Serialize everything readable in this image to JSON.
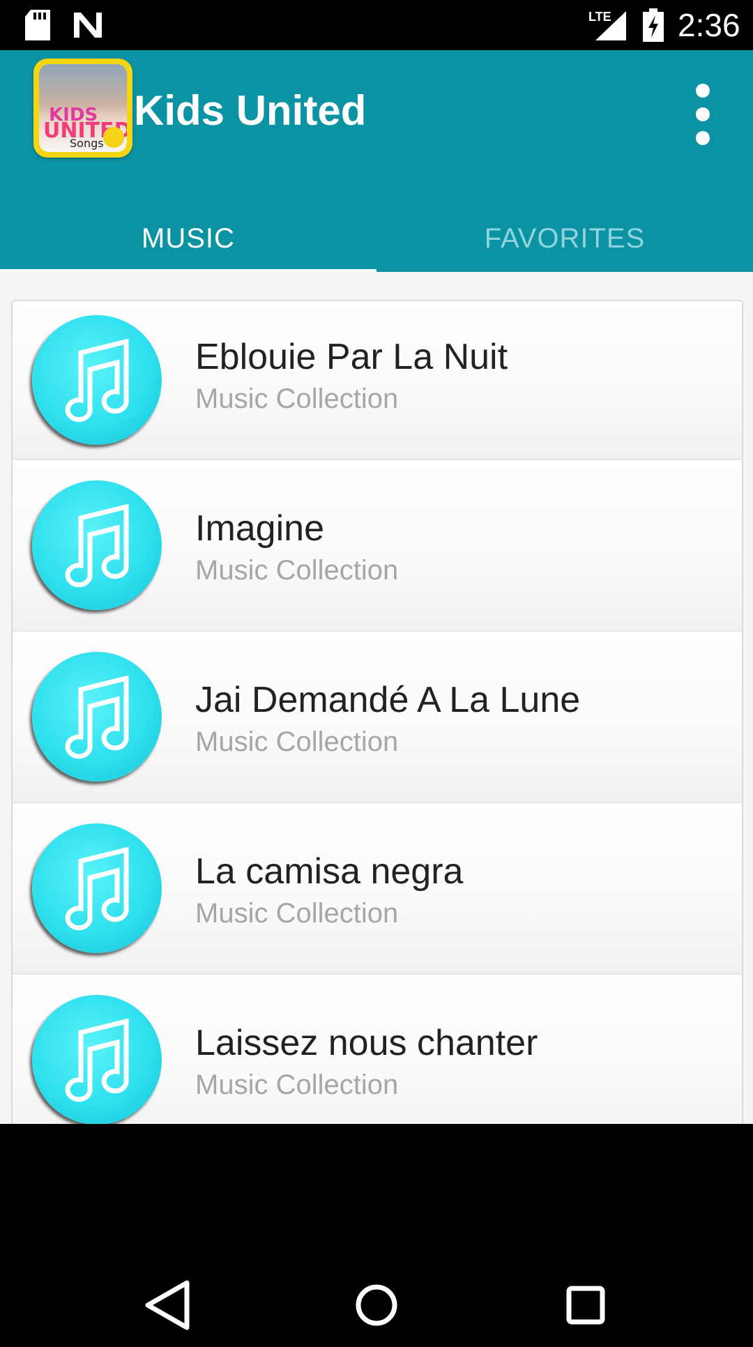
{
  "status_bar": {
    "network_label": "LTE",
    "time": "2:36"
  },
  "app_bar": {
    "title": "Kids United",
    "logo_text_kids": "KIDS",
    "logo_text_united": "UNITED",
    "logo_text_songs": "Songs"
  },
  "tabs": [
    {
      "label": "MUSIC",
      "selected": true
    },
    {
      "label": "FAVORITES",
      "selected": false
    }
  ],
  "songs": [
    {
      "title": "Eblouie Par La Nuit",
      "subtitle": "Music Collection",
      "icon": "music-note-icon"
    },
    {
      "title": "Imagine",
      "subtitle": "Music Collection",
      "icon": "music-note-icon"
    },
    {
      "title": "Jai Demandé A La Lune",
      "subtitle": "Music Collection",
      "icon": "music-note-icon"
    },
    {
      "title": "La camisa negra",
      "subtitle": "Music Collection",
      "icon": "music-note-icon"
    },
    {
      "title": "Laissez nous chanter",
      "subtitle": "Music Collection",
      "icon": "music-note-icon"
    }
  ],
  "colors": {
    "primary": "#0b93a4",
    "tab_inactive": "#8fd4de",
    "disc": "#2fe0ee",
    "subtitle": "#a6a6a6"
  },
  "nav_icons": [
    "back-icon",
    "home-icon",
    "recents-icon"
  ]
}
